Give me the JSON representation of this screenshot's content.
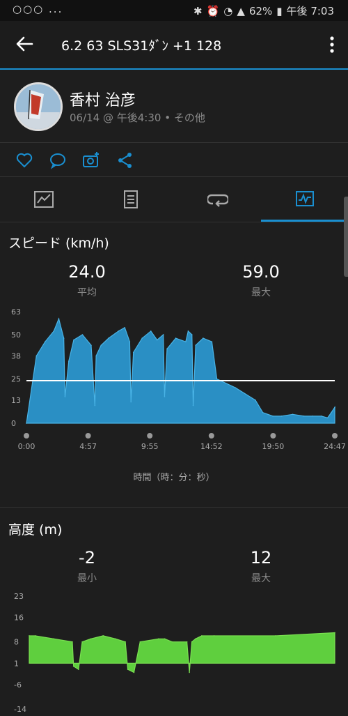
{
  "status": {
    "left": "○○○ ...",
    "battery": "62%",
    "time": "午後 7:03"
  },
  "appbar": {
    "title": "6.2 63 SLS31ﾀﾞﾝ +1 128"
  },
  "profile": {
    "name": "香村 治彦",
    "meta": "06/14 @ 午後4:30 • その他"
  },
  "colors": {
    "accent": "#1a8fd0",
    "speed_fill": "#2a8fc4",
    "elevation_fill": "#5fcf3e"
  },
  "speed": {
    "title": "スピード (km/h)",
    "avg_value": "24.0",
    "avg_label": "平均",
    "max_value": "59.0",
    "max_label": "最大",
    "x_axis_label": "時間（時：分：秒）"
  },
  "elevation": {
    "title": "高度 (m)",
    "min_value": "-2",
    "min_label": "最小",
    "max_value": "12",
    "max_label": "最大"
  },
  "chart_data": [
    {
      "type": "area",
      "title": "スピード (km/h)",
      "xlabel": "時間（時：分：秒）",
      "ylabel": "",
      "yticks": [
        "63",
        "50",
        "38",
        "25",
        "13",
        "0"
      ],
      "ylim": [
        0,
        63
      ],
      "xticks": [
        "0:00",
        "4:57",
        "9:55",
        "14:52",
        "19:50",
        "24:47"
      ],
      "avg_line": 24,
      "x": [
        0.0,
        0.8,
        1.5,
        2.2,
        2.6,
        3.0,
        3.1,
        3.4,
        3.8,
        4.5,
        5.2,
        5.5,
        5.6,
        6.0,
        6.6,
        7.4,
        7.9,
        8.3,
        8.4,
        8.6,
        9.3,
        10.0,
        10.5,
        11.0,
        11.1,
        11.3,
        12.0,
        12.8,
        13.0,
        13.3,
        13.4,
        13.6,
        14.2,
        14.9,
        15.3,
        16.8,
        18.4,
        19.0,
        19.8,
        20.5,
        21.4,
        22.3,
        23.0,
        23.7,
        24.2,
        24.5,
        24.78
      ],
      "values": [
        0,
        38,
        46,
        52,
        59,
        48,
        15,
        35,
        47,
        50,
        44,
        10,
        38,
        44,
        48,
        52,
        54,
        46,
        12,
        40,
        48,
        52,
        47,
        50,
        15,
        42,
        48,
        46,
        52,
        50,
        10,
        44,
        48,
        46,
        25,
        20,
        13,
        6,
        4,
        4,
        5,
        4,
        4,
        4,
        3,
        6,
        9
      ],
      "grid": false
    },
    {
      "type": "area",
      "title": "高度 (m)",
      "yticks": [
        "23",
        "16",
        "8",
        "1",
        "-6",
        "-14"
      ],
      "ylim": [
        -14,
        23
      ],
      "x": [
        0.0,
        0.5,
        2.0,
        3.5,
        3.6,
        4.0,
        4.3,
        5.0,
        6.0,
        7.0,
        7.8,
        8.0,
        8.5,
        9.0,
        10.5,
        11.0,
        11.6,
        12.8,
        13.0,
        13.2,
        13.5,
        14.0,
        15.0,
        20.0,
        24.8
      ],
      "values": [
        10,
        10,
        9,
        8,
        0,
        -1,
        8,
        9,
        10,
        9,
        8,
        -1,
        -2,
        8,
        9,
        9,
        8,
        8,
        -2,
        8,
        9,
        10,
        10,
        10,
        11
      ],
      "grid": false
    }
  ]
}
